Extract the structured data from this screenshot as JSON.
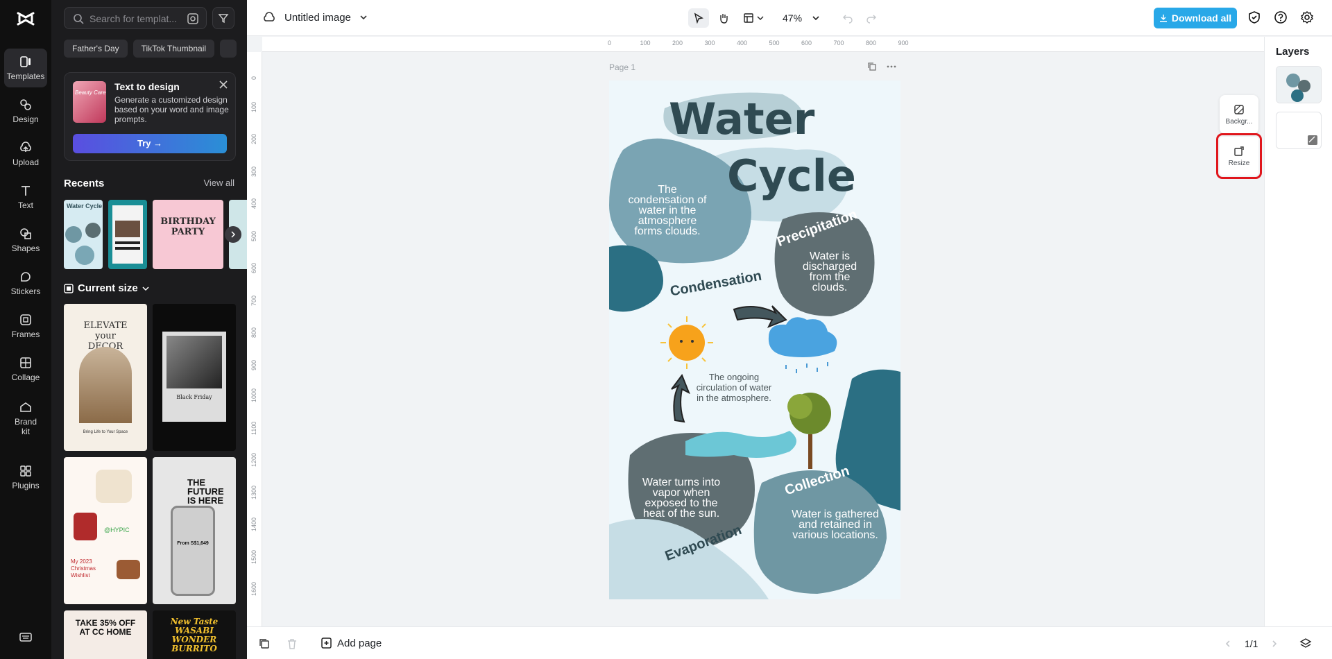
{
  "rail": {
    "items": [
      {
        "label": "Templates",
        "icon": "templates-icon"
      },
      {
        "label": "Design",
        "icon": "design-icon"
      },
      {
        "label": "Upload",
        "icon": "upload-icon"
      },
      {
        "label": "Text",
        "icon": "text-icon"
      },
      {
        "label": "Shapes",
        "icon": "shapes-icon"
      },
      {
        "label": "Stickers",
        "icon": "stickers-icon"
      },
      {
        "label": "Frames",
        "icon": "frames-icon"
      },
      {
        "label": "Collage",
        "icon": "collage-icon"
      },
      {
        "label": "Brand kit",
        "icon": "brand-kit-icon"
      },
      {
        "label": "Plugins",
        "icon": "plugins-icon"
      }
    ]
  },
  "panel": {
    "search_placeholder": "Search for templat...",
    "chips": [
      "Father's Day",
      "TikTok Thumbnail",
      ""
    ],
    "text_to_design": {
      "title": "Text to design",
      "description": "Generate a customized design based on your word and image prompts.",
      "thumb_text": "Beauty Care",
      "try_label": "Try →"
    },
    "recents_title": "Recents",
    "view_all": "View all",
    "recents": [
      {
        "text": "Water Cycle"
      },
      {
        "text": ""
      },
      {
        "text": "BIRTHDAY PARTY"
      },
      {
        "text": ""
      }
    ],
    "current_size": "Current size",
    "templates": [
      {
        "title": "ELEVATE your DECOR",
        "sub": "Bring Life to Your Space"
      },
      {
        "title": "Black Friday"
      },
      {
        "title": "My 2023 Christmas Wishlist",
        "handle": "@HYPIC"
      },
      {
        "title": "THE FUTURE IS HERE",
        "price": "From S$1,649"
      },
      {
        "title": "TAKE 35% OFF AT CC HOME"
      },
      {
        "title": "New Taste WASABI WONDER BURRITO"
      }
    ]
  },
  "topbar": {
    "doc_title": "Untitled image",
    "zoom": "47%",
    "download_label": "Download all"
  },
  "canvas": {
    "ruler_top": [
      "0",
      "100",
      "200",
      "300",
      "400",
      "500",
      "600",
      "700",
      "800",
      "900"
    ],
    "ruler_left": [
      "0",
      "100",
      "200",
      "300",
      "400",
      "500",
      "600",
      "700",
      "800",
      "900",
      "1000",
      "1100",
      "1200",
      "1300",
      "1400",
      "1500",
      "1600"
    ],
    "page_label": "Page 1",
    "artwork": {
      "title_line1": "Water",
      "title_line2": "Cycle",
      "condensation_note": "The condensation of water in the atmosphere forms clouds.",
      "precipitation": "Precipitation",
      "precipitation_note": "Water is discharged from the clouds.",
      "condensation": "Condensation",
      "center_note": "The ongoing circulation of water in the atmosphere.",
      "evaporation_note": "Water turns into vapor when exposed to the heat of the sun.",
      "collection": "Collection",
      "collection_note": "Water is gathered and retained in various locations.",
      "evaporation": "Evaporation"
    },
    "side_background": "Backgr...",
    "side_resize": "Resize"
  },
  "bottombar": {
    "add_page": "Add page",
    "pager": "1/1"
  },
  "layers": {
    "title": "Layers"
  }
}
